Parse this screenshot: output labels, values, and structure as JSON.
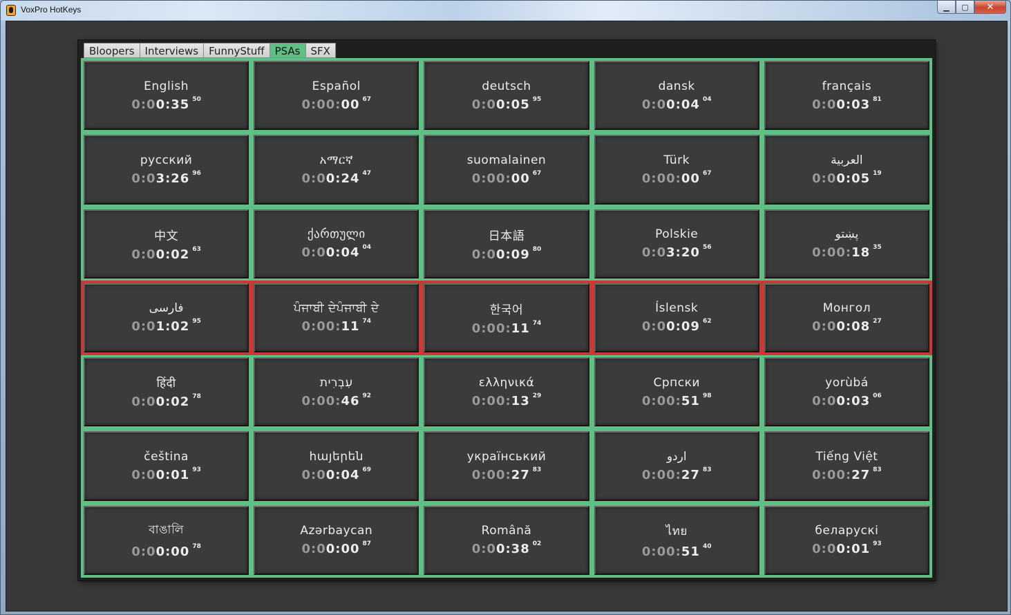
{
  "window": {
    "title": "VoxPro HotKeys",
    "controls": {
      "minimize": "▁",
      "maximize": "▢",
      "close": "✕"
    }
  },
  "tabs": [
    {
      "label": "Bloopers",
      "active": false
    },
    {
      "label": "Interviews",
      "active": false
    },
    {
      "label": "FunnyStuff",
      "active": false
    },
    {
      "label": "PSAs",
      "active": true
    },
    {
      "label": "SFX",
      "active": false
    }
  ],
  "colors": {
    "active_tab": "#5fbf85",
    "grid_border": "#5fbf85",
    "highlight_row": "#c83a36"
  },
  "highlighted_row": 3,
  "hotkeys": [
    {
      "label": "English",
      "dim": "0:0",
      "bright": "0:35",
      "frac": "50"
    },
    {
      "label": "Español",
      "dim": "0:00:",
      "bright": "00",
      "frac": "67"
    },
    {
      "label": "deutsch",
      "dim": "0:0",
      "bright": "0:05",
      "frac": "95"
    },
    {
      "label": "dansk",
      "dim": "0:0",
      "bright": "0:04",
      "frac": "04"
    },
    {
      "label": "français",
      "dim": "0:0",
      "bright": "0:03",
      "frac": "81"
    },
    {
      "label": "русский",
      "dim": "0:0",
      "bright": "3:26",
      "frac": "96"
    },
    {
      "label": "አማርኛ",
      "dim": "0:0",
      "bright": "0:24",
      "frac": "47"
    },
    {
      "label": "suomalainen",
      "dim": "0:00:",
      "bright": "00",
      "frac": "67"
    },
    {
      "label": "Türk",
      "dim": "0:00:",
      "bright": "00",
      "frac": "67"
    },
    {
      "label": "العربية",
      "dim": "0:0",
      "bright": "0:05",
      "frac": "19"
    },
    {
      "label": "中文",
      "dim": "0:0",
      "bright": "0:02",
      "frac": "63"
    },
    {
      "label": "ქართული",
      "dim": "0:0",
      "bright": "0:04",
      "frac": "04"
    },
    {
      "label": "日本語",
      "dim": "0:0",
      "bright": "0:09",
      "frac": "80"
    },
    {
      "label": "Polskie",
      "dim": "0:0",
      "bright": "3:20",
      "frac": "56"
    },
    {
      "label": "پښتو",
      "dim": "0:00:",
      "bright": "18",
      "frac": "35"
    },
    {
      "label": "فارسی",
      "dim": "0:0",
      "bright": "1:02",
      "frac": "95"
    },
    {
      "label": "ਪੰਜਾਬੀ ਦੇਪੰਜਾਬੀ ਦੇ",
      "dim": "0:00:",
      "bright": "11",
      "frac": "74"
    },
    {
      "label": "한국어",
      "dim": "0:00:",
      "bright": "11",
      "frac": "74"
    },
    {
      "label": "Íslensk",
      "dim": "0:0",
      "bright": "0:09",
      "frac": "62"
    },
    {
      "label": "Монгол",
      "dim": "0:0",
      "bright": "0:08",
      "frac": "27"
    },
    {
      "label": "हिंदी",
      "dim": "0:0",
      "bright": "0:02",
      "frac": "78"
    },
    {
      "label": "עִבְרִית",
      "dim": "0:00:",
      "bright": "46",
      "frac": "92"
    },
    {
      "label": "ελληνικά",
      "dim": "0:00:",
      "bright": "13",
      "frac": "29"
    },
    {
      "label": "Српски",
      "dim": "0:00:",
      "bright": "51",
      "frac": "98"
    },
    {
      "label": "yorùbá",
      "dim": "0:0",
      "bright": "0:03",
      "frac": "06"
    },
    {
      "label": "čeština",
      "dim": "0:0",
      "bright": "0:01",
      "frac": "93"
    },
    {
      "label": "հայերեն",
      "dim": "0:0",
      "bright": "0:04",
      "frac": "69"
    },
    {
      "label": "український",
      "dim": "0:00:",
      "bright": "27",
      "frac": "83"
    },
    {
      "label": "اردو",
      "dim": "0:00:",
      "bright": "27",
      "frac": "83"
    },
    {
      "label": "Tiếng Việt",
      "dim": "0:00:",
      "bright": "27",
      "frac": "83"
    },
    {
      "label": "বাঙালি",
      "dim": "0:0",
      "bright": "0:00",
      "frac": "78"
    },
    {
      "label": "Azərbaycan",
      "dim": "0:0",
      "bright": "0:00",
      "frac": "87"
    },
    {
      "label": "Română",
      "dim": "0:0",
      "bright": "0:38",
      "frac": "02"
    },
    {
      "label": "ไทย",
      "dim": "0:00:",
      "bright": "51",
      "frac": "40"
    },
    {
      "label": "беларускі",
      "dim": "0:0",
      "bright": "0:01",
      "frac": "93"
    }
  ]
}
